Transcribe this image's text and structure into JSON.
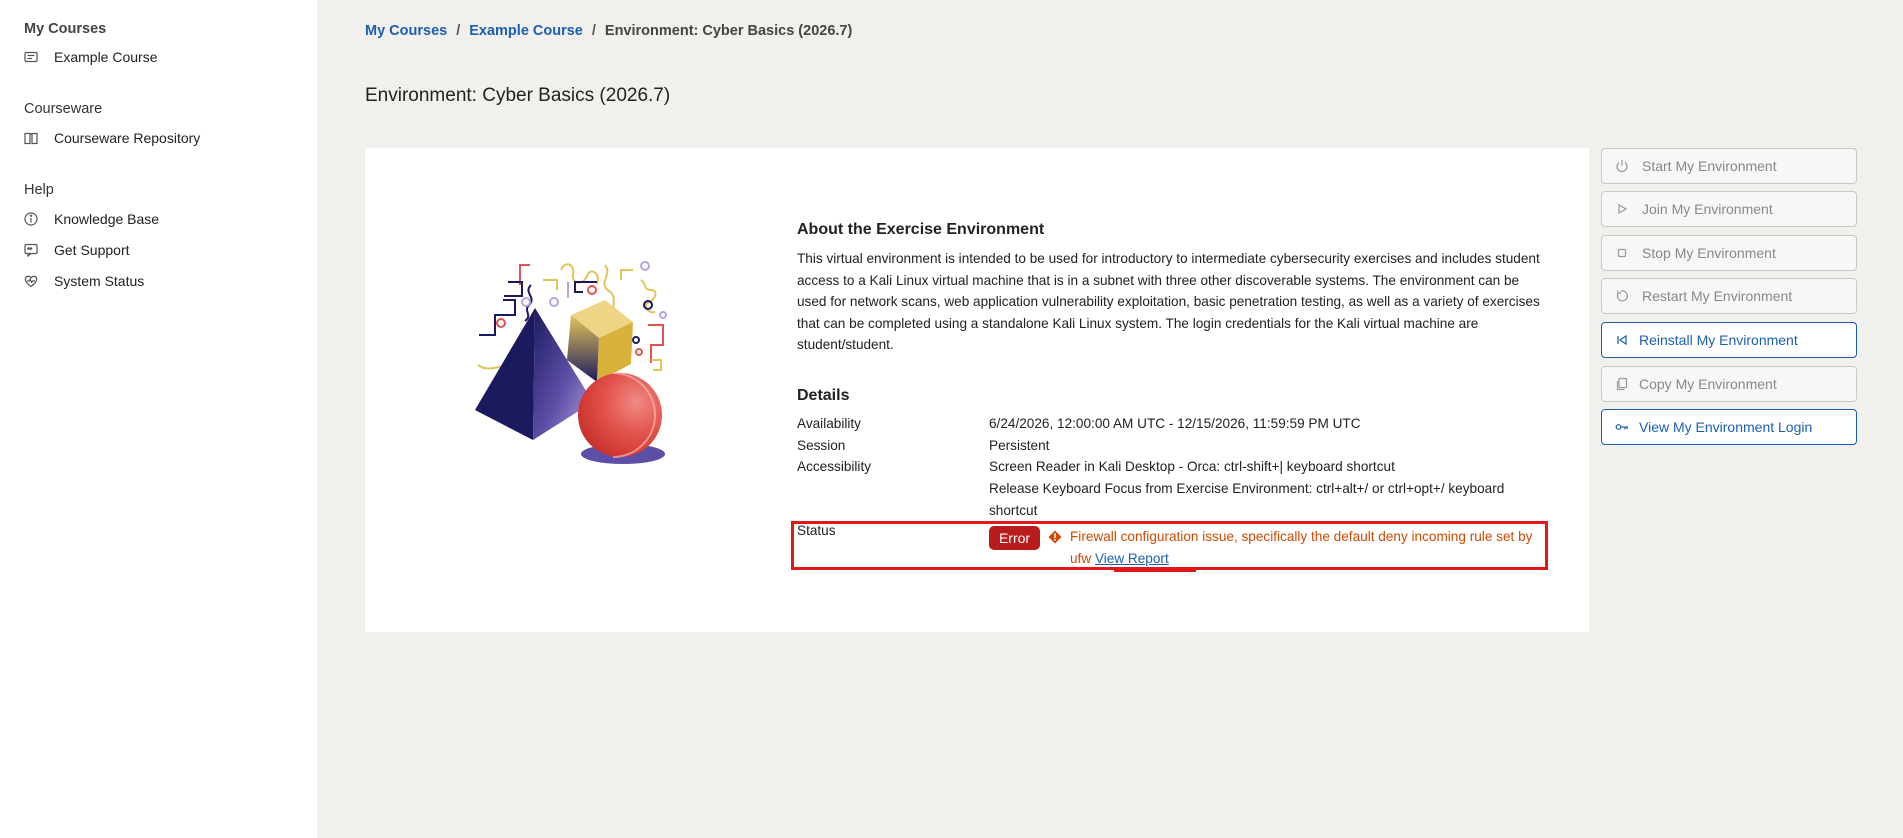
{
  "sidebar": {
    "my_courses_heading": "My Courses",
    "example_course": "Example Course",
    "courseware_heading": "Courseware",
    "courseware_repository": "Courseware Repository",
    "help_heading": "Help",
    "knowledge_base": "Knowledge Base",
    "get_support": "Get Support",
    "system_status": "System Status"
  },
  "breadcrumb": {
    "my_courses": "My Courses",
    "example_course": "Example Course",
    "current": "Environment: Cyber Basics (2026.7)",
    "separator": "/"
  },
  "page_title": "Environment: Cyber Basics (2026.7)",
  "about": {
    "title": "About the Exercise Environment",
    "text": "This virtual environment is intended to be used for introductory to intermediate cybersecurity exercises and includes student access to a Kali Linux virtual machine that is in a subnet with three other discoverable systems. The environment can be used for network scans, web application vulnerability exploitation, basic penetration testing, as well as a variety of exercises that can be completed using a standalone Kali Linux system. The login credentials for the Kali virtual machine are student/student."
  },
  "details": {
    "title": "Details",
    "availability_label": "Availability",
    "availability_value": "6/24/2026, 12:00:00 AM UTC - 12/15/2026, 11:59:59 PM UTC",
    "session_label": "Session",
    "session_value": "Persistent",
    "accessibility_label": "Accessibility",
    "accessibility_value_1": "Screen Reader in Kali Desktop - Orca: ctrl-shift+| keyboard shortcut",
    "accessibility_value_2": "Release Keyboard Focus from Exercise Environment: ctrl+alt+/ or ctrl+opt+/ keyboard shortcut",
    "status_label": "Status",
    "status_badge": "Error",
    "status_message": "Firewall configuration issue, specifically the default deny incoming rule set by ufw",
    "view_report": "View Report"
  },
  "actions": {
    "start": "Start My Environment",
    "join": "Join My Environment",
    "stop": "Stop My Environment",
    "restart": "Restart My Environment",
    "reinstall": "Reinstall My Environment",
    "copy": "Copy My Environment",
    "view_login": "View My Environment Login"
  },
  "colors": {
    "accent": "#1b5fb4",
    "error": "#b81c1c",
    "warning_text": "#d14a00",
    "highlight": "#e01818",
    "background": "#f1f0ec"
  }
}
